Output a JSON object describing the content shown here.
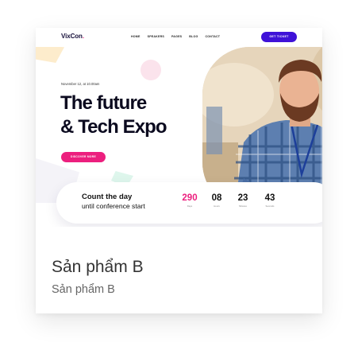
{
  "mockup": {
    "logo": {
      "text": "VixCon",
      "dot": "."
    },
    "nav": {
      "links": [
        "HOME",
        "SPEAKERS",
        "PAGES",
        "BLOG",
        "CONTACT"
      ]
    },
    "ticket_button": "GET TICKET",
    "hero": {
      "date": "November 12, at 10.00am",
      "title_line1": "The future",
      "title_line2": "& Tech Expo",
      "cta": "DISCOVER MORE"
    },
    "countdown": {
      "title": "Count the day",
      "subtitle": "until conference start",
      "units": [
        {
          "value": "290",
          "label": "Days"
        },
        {
          "value": "08",
          "label": "Hours"
        },
        {
          "value": "23",
          "label": "Minutes"
        },
        {
          "value": "43",
          "label": "Seconds"
        }
      ]
    }
  },
  "caption": {
    "title": "Sản phẩm B",
    "subtitle": "Sản phẩm B"
  },
  "colors": {
    "accent_pink": "#ec1f7e",
    "accent_purple": "#3f12d8",
    "text_dark": "#0b0a1f"
  }
}
